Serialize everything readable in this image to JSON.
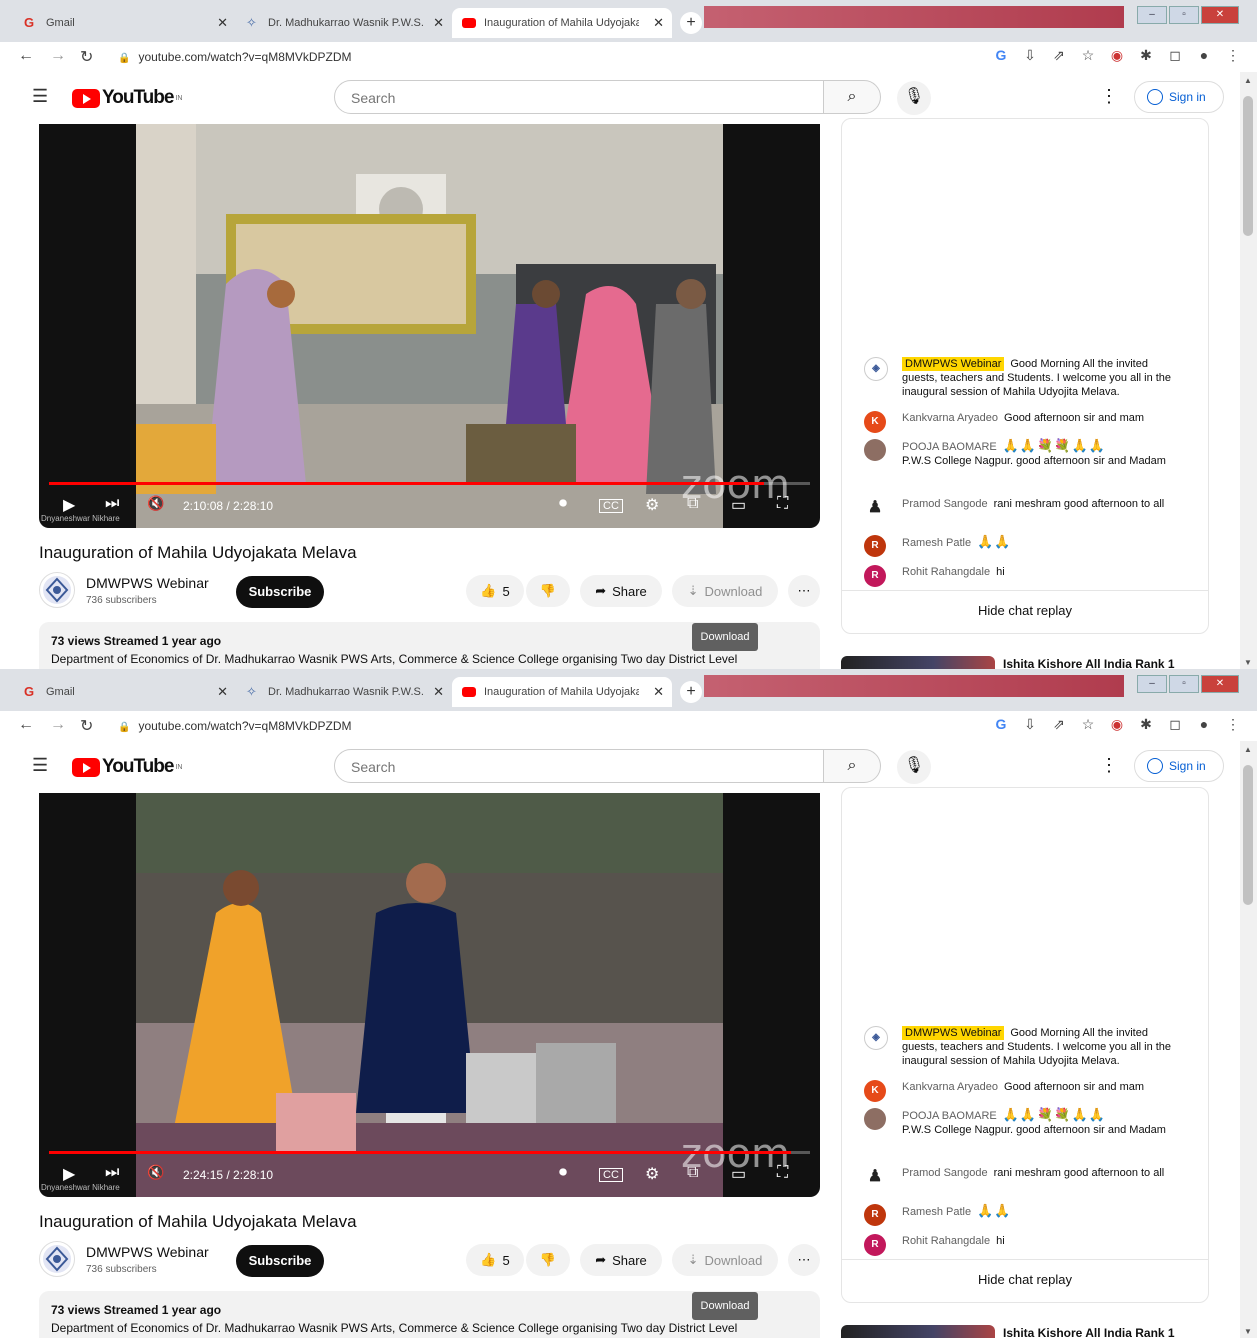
{
  "browser": {
    "tabs": [
      {
        "label": "Gmail",
        "icon": "gmail-icon"
      },
      {
        "label": "Dr. Madhukarrao Wasnik P.W.S.",
        "icon": "college-icon"
      },
      {
        "label": "Inauguration of Mahila Udyojaka",
        "icon": "youtube-icon",
        "active": true
      }
    ],
    "url": "youtube.com/watch?v=qM8MVkDPZDM"
  },
  "youtube": {
    "logo_text": "YouTube",
    "logo_region": "IN",
    "search_placeholder": "Search",
    "signin_label": "Sign in"
  },
  "frames": [
    {
      "time": "2:10:08 / 2:28:10",
      "progress": 0.94,
      "scene": "stall"
    },
    {
      "time": "2:24:15 / 2:28:10",
      "progress": 0.975,
      "scene": "outdoor"
    }
  ],
  "video": {
    "title": "Inauguration of Mahila Udyojakata Melava",
    "watermark": "zoom",
    "camera_label": "Dnyaneshwar Nikhare",
    "channel": {
      "name": "DMWPWS Webinar",
      "subscribers": "736 subscribers",
      "subscribe_label": "Subscribe"
    },
    "likes": "5",
    "share_label": "Share",
    "download_label": "Download",
    "tooltip": "Download",
    "meta": "73 views  Streamed 1 year ago",
    "description": "Department of Economics of Dr. Madhukarrao Wasnik PWS Arts, Commerce & Science College organising Two day District Level"
  },
  "chat": {
    "hide_label": "Hide chat replay",
    "messages": [
      {
        "author": "DMWPWS Webinar",
        "owner": true,
        "avatar_color": "#ffffff",
        "avatar_letter": "",
        "text": "Good Morning All the invited guests, teachers and Students. I welcome you all in the inaugural session of Mahila Udyojita Melava."
      },
      {
        "author": "Kankvarna Aryadeo",
        "avatar_color": "#e64a19",
        "avatar_letter": "K",
        "text": "Good afternoon sir and mam"
      },
      {
        "author": "POOJA BAOMARE",
        "avatar_color": "#8d6e63",
        "avatar_letter": "",
        "text": "P.W.S College Nagpur. good afternoon sir and Madam",
        "emoji": "🙏🙏💐💐🙏🙏"
      },
      {
        "author": "Pramod Sangode",
        "avatar_color": "#212121",
        "avatar_letter": "",
        "text": "rani meshram good afternoon to all"
      },
      {
        "author": "Ramesh Patle",
        "avatar_color": "#bf360c",
        "avatar_letter": "R",
        "text": "",
        "emoji": "🙏🙏"
      },
      {
        "author": "Rohit Rahangdale",
        "avatar_color": "#c2185b",
        "avatar_letter": "R",
        "text": "hi"
      }
    ]
  },
  "recommended": {
    "title": "Ishita Kishore All India Rank 1"
  }
}
